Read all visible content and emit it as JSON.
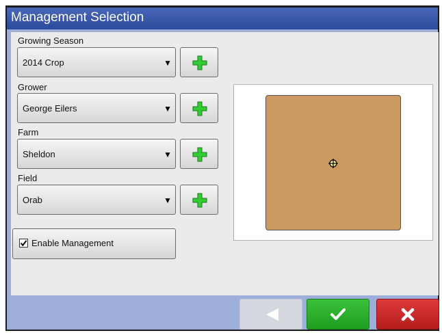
{
  "window": {
    "title": "Management Selection"
  },
  "fields": [
    {
      "label": "Growing Season",
      "value": "2014 Crop"
    },
    {
      "label": "Grower",
      "value": "George Eilers"
    },
    {
      "label": "Farm",
      "value": "Sheldon"
    },
    {
      "label": "Field",
      "value": "Orab"
    }
  ],
  "enable_management": {
    "label": "Enable Management",
    "checked": true
  },
  "icons": {
    "add": "plus-icon",
    "dropdown": "triangle-down-icon",
    "back": "arrow-left-icon",
    "accept": "checkmark-icon",
    "cancel": "x-icon",
    "field_center": "crosshair-icon"
  },
  "colors": {
    "title_bar": "#2c4a9c",
    "field_boundary_fill": "#cc9960",
    "accept": "#1f9c1f",
    "cancel": "#b41c1c",
    "add_plus": "#33cc33"
  }
}
